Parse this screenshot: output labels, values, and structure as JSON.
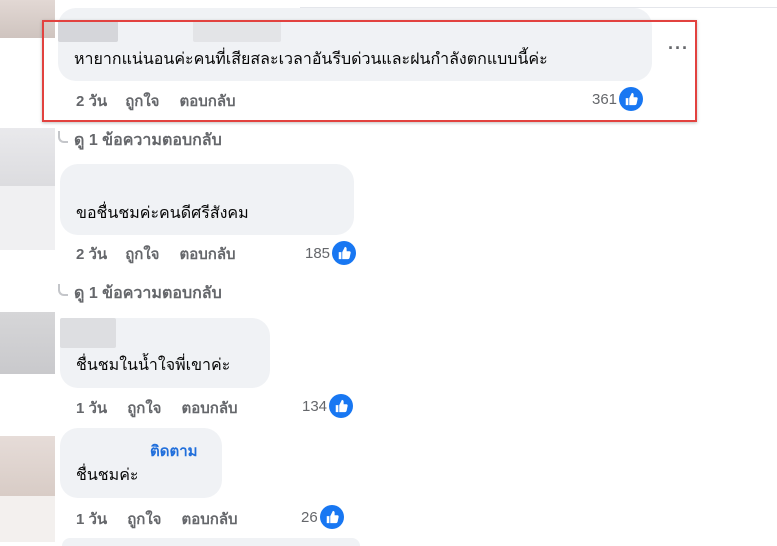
{
  "comments": [
    {
      "text": "หายากแน่นอนค่ะคนที่เสียสละเวลาอันรีบด่วนและฝนกำลังตกแบบนี้ค่ะ",
      "age": "2 วัน",
      "like_label": "ถูกใจ",
      "reply_label": "ตอบกลับ",
      "reaction_count": "361",
      "view_replies": "ดู 1 ข้อความตอบกลับ"
    },
    {
      "text": "ขอชื่นชมค่ะคนดีศรีสังคม",
      "age": "2 วัน",
      "like_label": "ถูกใจ",
      "reply_label": "ตอบกลับ",
      "reaction_count": "185",
      "view_replies": "ดู 1 ข้อความตอบกลับ"
    },
    {
      "text": "ชื่นชมในน้ำใจพี่เขาค่ะ",
      "age": "1 วัน",
      "like_label": "ถูกใจ",
      "reply_label": "ตอบกลับ",
      "reaction_count": "134"
    },
    {
      "follow_label": "ติดตาม",
      "text": "ชื่นชมค่ะ",
      "age": "1 วัน",
      "like_label": "ถูกใจ",
      "reply_label": "ตอบกลับ",
      "reaction_count": "26"
    }
  ],
  "icons": {
    "like": "thumbs-up-icon",
    "more": "more-options-icon"
  },
  "colors": {
    "highlight": "#e2423f",
    "like_badge": "#1877f2",
    "follow": "#216fdb"
  }
}
